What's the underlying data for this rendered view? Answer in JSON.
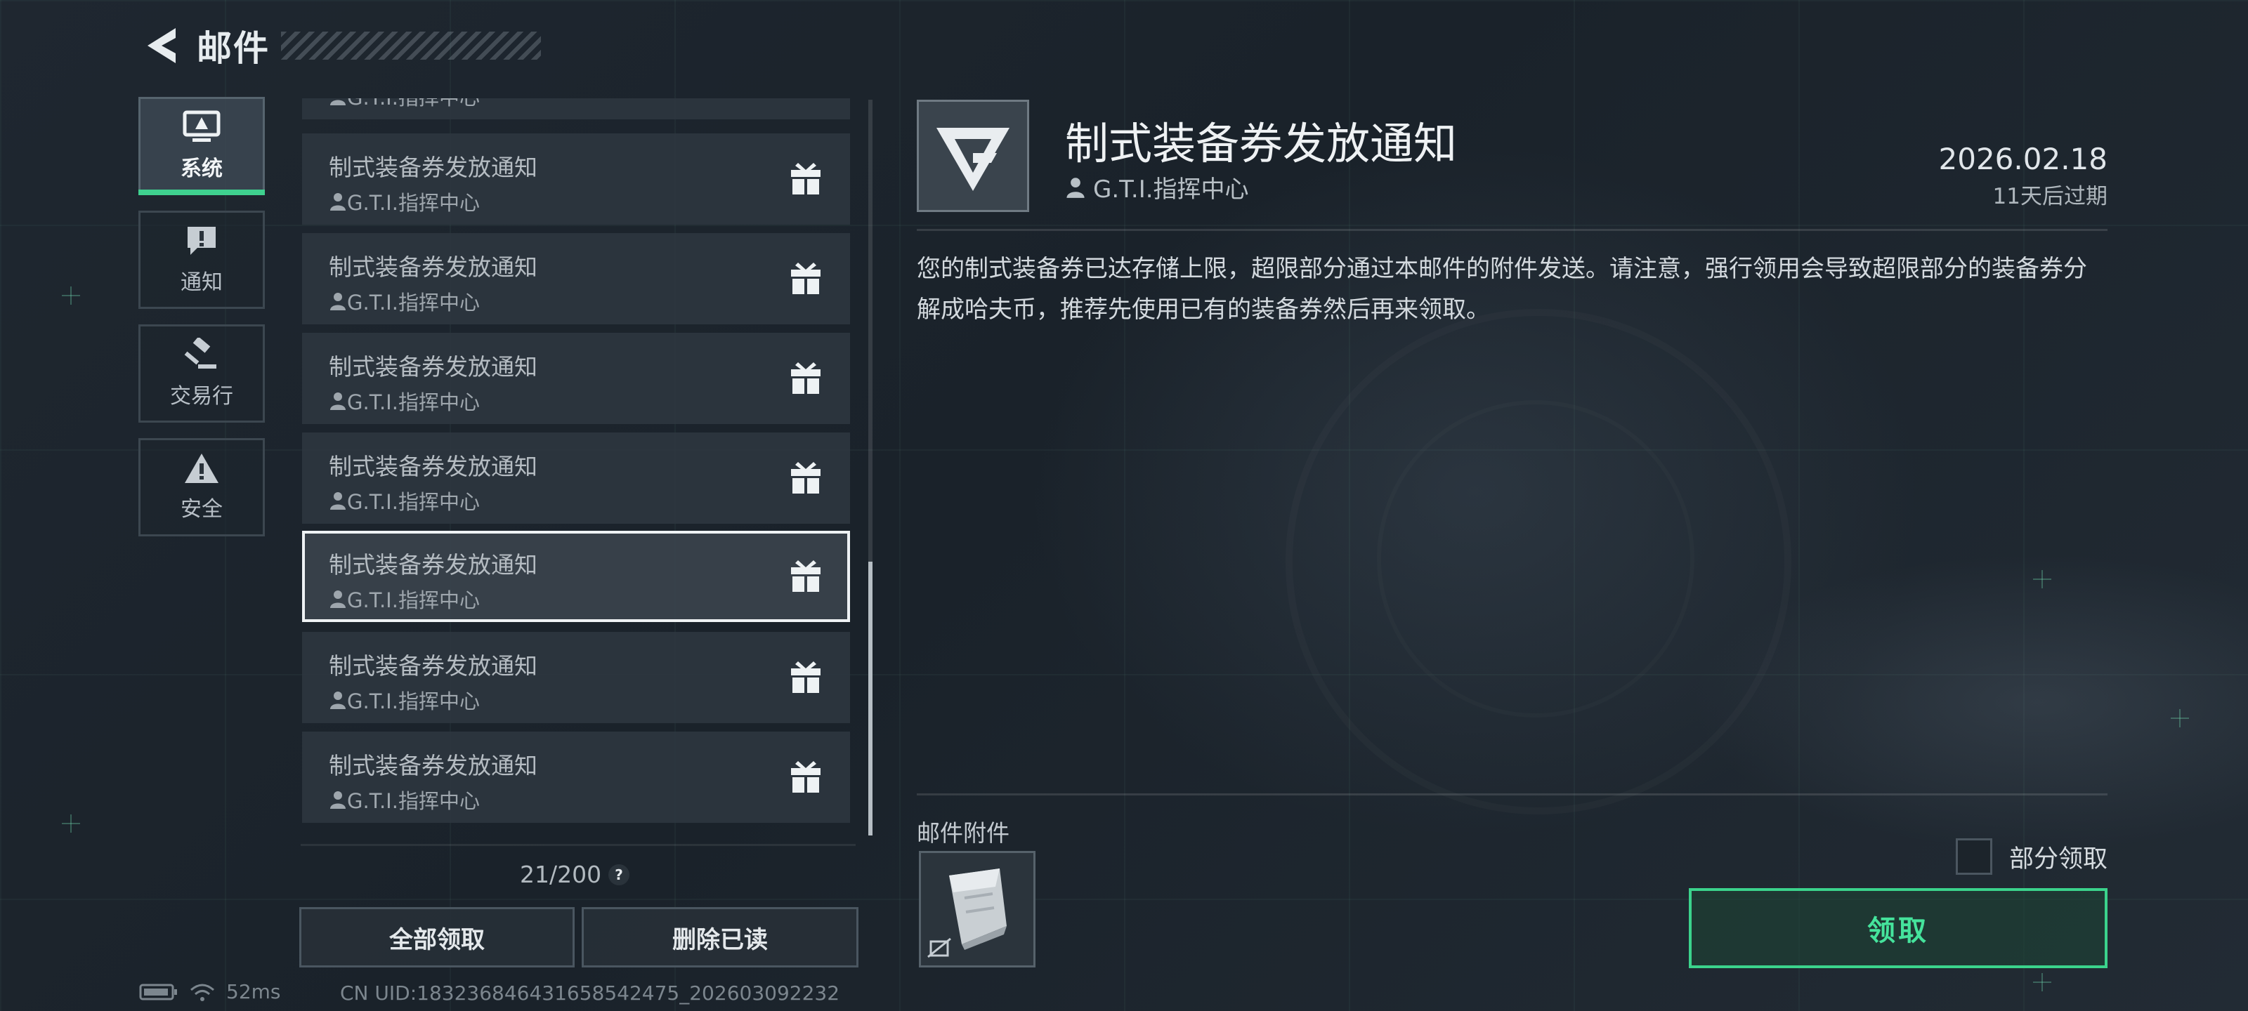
{
  "header": {
    "title": "邮件"
  },
  "categories": [
    {
      "label": "系统",
      "icon": "monitor-alert-icon",
      "active": true
    },
    {
      "label": "通知",
      "icon": "message-alert-icon",
      "active": false
    },
    {
      "label": "交易行",
      "icon": "gavel-icon",
      "active": false
    },
    {
      "label": "安全",
      "icon": "warning-triangle-icon",
      "active": false
    }
  ],
  "mail_list": {
    "partial_top_sender": "G.T.I.指挥中心",
    "items": [
      {
        "title": "制式装备券发放通知",
        "sender": "G.T.I.指挥中心",
        "selected": false
      },
      {
        "title": "制式装备券发放通知",
        "sender": "G.T.I.指挥中心",
        "selected": false
      },
      {
        "title": "制式装备券发放通知",
        "sender": "G.T.I.指挥中心",
        "selected": false
      },
      {
        "title": "制式装备券发放通知",
        "sender": "G.T.I.指挥中心",
        "selected": false
      },
      {
        "title": "制式装备券发放通知",
        "sender": "G.T.I.指挥中心",
        "selected": true
      },
      {
        "title": "制式装备券发放通知",
        "sender": "G.T.I.指挥中心",
        "selected": false
      },
      {
        "title": "制式装备券发放通知",
        "sender": "G.T.I.指挥中心",
        "selected": false
      }
    ],
    "count": "21/200",
    "help": "?",
    "claim_all_label": "全部领取",
    "delete_read_label": "删除已读"
  },
  "detail": {
    "title": "制式装备券发放通知",
    "sender": "G.T.I.指挥中心",
    "date": "2026.02.18",
    "expire": "11天后过期",
    "body": "您的制式装备券已达存储上限，超限部分通过本邮件的附件发送。请注意，强行领用会导致超限部分的装备券分解成哈夫币，推荐先使用已有的装备券然后再来领取。",
    "attachments_label": "邮件附件",
    "partial_claim_label": "部分领取",
    "claim_label": "领取"
  },
  "status_bar": {
    "ping": "52ms",
    "uid": "CN UID:18323684643165854247​5_202603092232"
  },
  "colors": {
    "accent": "#3fd18f",
    "claim_text": "#45e39c"
  }
}
